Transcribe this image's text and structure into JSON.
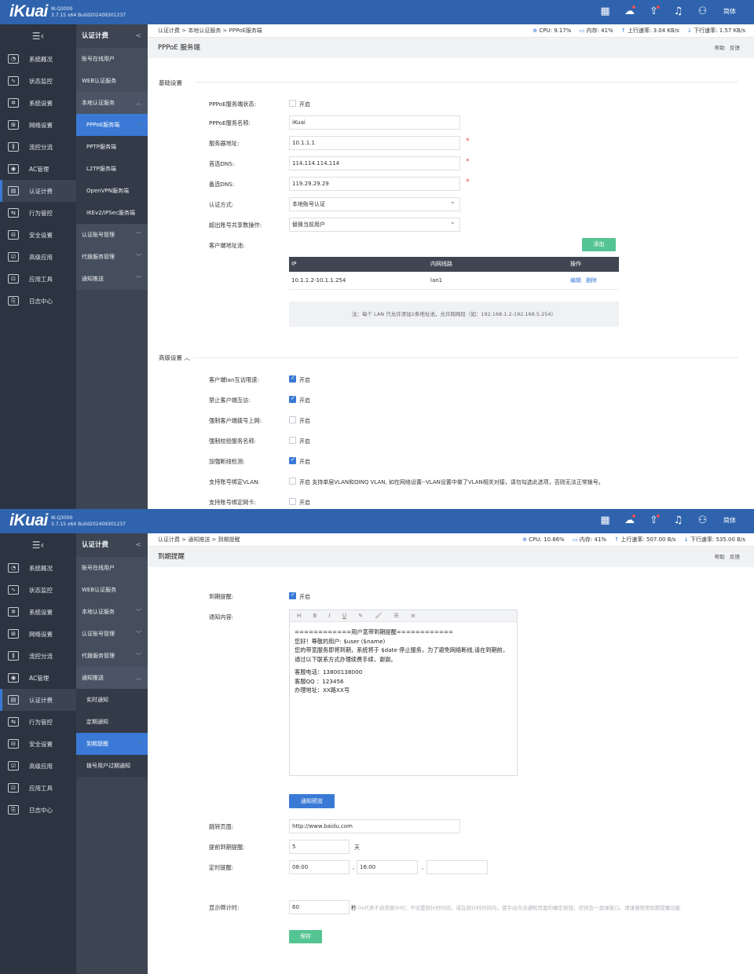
{
  "topbar": {
    "logo": "iKuai",
    "model_line1": "IK-Q3000",
    "model_line2": "3.7.15 x64 Build202409301237",
    "lang": "简体"
  },
  "sidebar": {
    "items": [
      {
        "label": "系统概况",
        "icon": "dashboard-icon"
      },
      {
        "label": "状态监控",
        "icon": "monitor-icon"
      },
      {
        "label": "系统设置",
        "icon": "gear-icon"
      },
      {
        "label": "网络设置",
        "icon": "network-icon"
      },
      {
        "label": "流控分流",
        "icon": "flow-icon"
      },
      {
        "label": "AC管理",
        "icon": "wifi-icon"
      },
      {
        "label": "认证计费",
        "icon": "auth-icon"
      },
      {
        "label": "行为管控",
        "icon": "behavior-icon"
      },
      {
        "label": "安全设置",
        "icon": "security-icon"
      },
      {
        "label": "高级应用",
        "icon": "advanced-icon"
      },
      {
        "label": "应用工具",
        "icon": "tools-icon"
      },
      {
        "label": "日志中心",
        "icon": "log-icon"
      }
    ]
  },
  "shot1": {
    "submenu": {
      "title": "认证计费",
      "items": [
        {
          "label": "账号在线用户"
        },
        {
          "label": "WEB认证服务"
        },
        {
          "label": "本地认证服务",
          "arrow": "︿"
        },
        {
          "label": "PPPoE服务端"
        },
        {
          "label": "PPTP服务端"
        },
        {
          "label": "L2TP服务端"
        },
        {
          "label": "OpenVPN服务端"
        },
        {
          "label": "IKEv2/IPSec服务端"
        },
        {
          "label": "认证账号管理",
          "arrow": "﹀"
        },
        {
          "label": "代拨服务管理",
          "arrow": "﹀"
        },
        {
          "label": "通知推送",
          "arrow": "﹀"
        }
      ]
    },
    "breadcrumb": "认证计费 > 本地认证服务 > PPPoE服务端",
    "stats": {
      "cpu_label": "CPU:",
      "cpu": "9.17%",
      "mem_label": "内存:",
      "mem": "41%",
      "up_label": "上行速率:",
      "up": "3.04 KB/s",
      "down_label": "下行速率:",
      "down": "1.57 KB/s"
    },
    "page_title": "PPPoE 服务端",
    "help": "帮助",
    "feedback": "反馈",
    "basic_title": "基础设置",
    "fields": {
      "status_label": "PPPoE服务端状态:",
      "status_text": "开启",
      "name_label": "PPPoE服务名称:",
      "name_value": "iKuai",
      "server_label": "服务器地址:",
      "server_value": "10.1.1.1",
      "dns1_label": "首选DNS:",
      "dns1_value": "114.114.114.114",
      "dns2_label": "备选DNS:",
      "dns2_value": "119.29.29.29",
      "auth_label": "认证方式:",
      "auth_value": "本地账号认证",
      "share_label": "超出账号共享数操作:",
      "share_value": "替换当前用户",
      "pool_label": "客户端地址池:",
      "req": "*"
    },
    "add_button": "添加",
    "table": {
      "headers": [
        "IP",
        "内网线路",
        "操作"
      ],
      "rows": [
        {
          "ip": "10.1.1.2-10.1.1.254",
          "line": "lan1",
          "edit": "编辑",
          "del": "删除"
        }
      ]
    },
    "note": "注：每个 LAN 只允许添加1条地址池，允许跨网段（如：192.168.1.2-192.168.5.254）",
    "advanced_title": "高级设置 ︿",
    "adv": [
      {
        "label": "客户端lan互访限速:",
        "text": "开启",
        "checked": true
      },
      {
        "label": "禁止客户端互访:",
        "text": "开启",
        "checked": true
      },
      {
        "label": "强制客户端拨号上网:",
        "text": "开启",
        "checked": false
      },
      {
        "label": "强制校验服务名称:",
        "text": "开启",
        "checked": false
      },
      {
        "label": "加强断线检测:",
        "text": "开启",
        "checked": true
      },
      {
        "label": "支持账号绑定VLAN:",
        "text": "开启   支持单层VLAN和QINQ VLAN, 如在网络设置--VLAN设置中做了VLAN相关对接，请勿勾选此选项，否则无法正常拨号。",
        "checked": false
      },
      {
        "label": "支持账号绑定网卡:",
        "text": "开启",
        "checked": false
      }
    ]
  },
  "shot2": {
    "submenu": {
      "title": "认证计费",
      "items": [
        {
          "label": "账号在线用户"
        },
        {
          "label": "WEB认证服务"
        },
        {
          "label": "本地认证服务",
          "arrow": "﹀"
        },
        {
          "label": "认证账号管理",
          "arrow": "﹀"
        },
        {
          "label": "代拨服务管理",
          "arrow": "﹀"
        },
        {
          "label": "通知推送",
          "arrow": "︿"
        },
        {
          "label": "实时通知"
        },
        {
          "label": "定期通知"
        },
        {
          "label": "到期提醒"
        },
        {
          "label": "拨号用户过期通知"
        }
      ]
    },
    "breadcrumb": "认证计费 > 通知推送 > 到期提醒",
    "stats": {
      "cpu_label": "CPU:",
      "cpu": "10.86%",
      "mem_label": "内存:",
      "mem": "41%",
      "up_label": "上行速率:",
      "up": "507.00 B/s",
      "down_label": "下行速率:",
      "down": "535.00 B/s"
    },
    "page_title": "到期提醒",
    "help": "帮助",
    "feedback": "反馈",
    "expire_label": "到期提醒:",
    "expire_text": "开启",
    "content_label": "通知内容:",
    "toolbar": [
      "H",
      "B",
      "I",
      "U",
      "✎",
      "🖌",
      "☰",
      "≡"
    ],
    "content": {
      "line1": "============用户宽带到期提醒============",
      "line2": "您好！尊敬的用户: $user ($name)",
      "line3": "您的带宽服务即将到期，系统将于 $date 停止服务，为了避免网络断线,请在到期前，通过以下联系方式办理续费手续，谢谢。",
      "line4": "客服电话：13800138000",
      "line5": "客服QQ ：123456",
      "line6": "办理地址：XX路XX号"
    },
    "preview_button": "通知预览",
    "jump_label": "跳转页面:",
    "jump_value": "http://www.baidu.com",
    "advance_label": "提前到期提醒:",
    "advance_value": "5",
    "advance_unit": "天",
    "timer_label": "定时提醒:",
    "timer1": "08:00",
    "timer2": "16:00",
    "timer3": "",
    "comma": ",",
    "countdown_label": "显示倒计时:",
    "countdown_value": "60",
    "countdown_unit": "秒",
    "countdown_hint": "0s代表不启用倒计时；不设置倒计时时间，或在倒计时时间内，需手动点击通知页面的确定按钮，否则会一直弹窗口。请谨慎使用到期提醒功能",
    "save_button": "保存"
  }
}
